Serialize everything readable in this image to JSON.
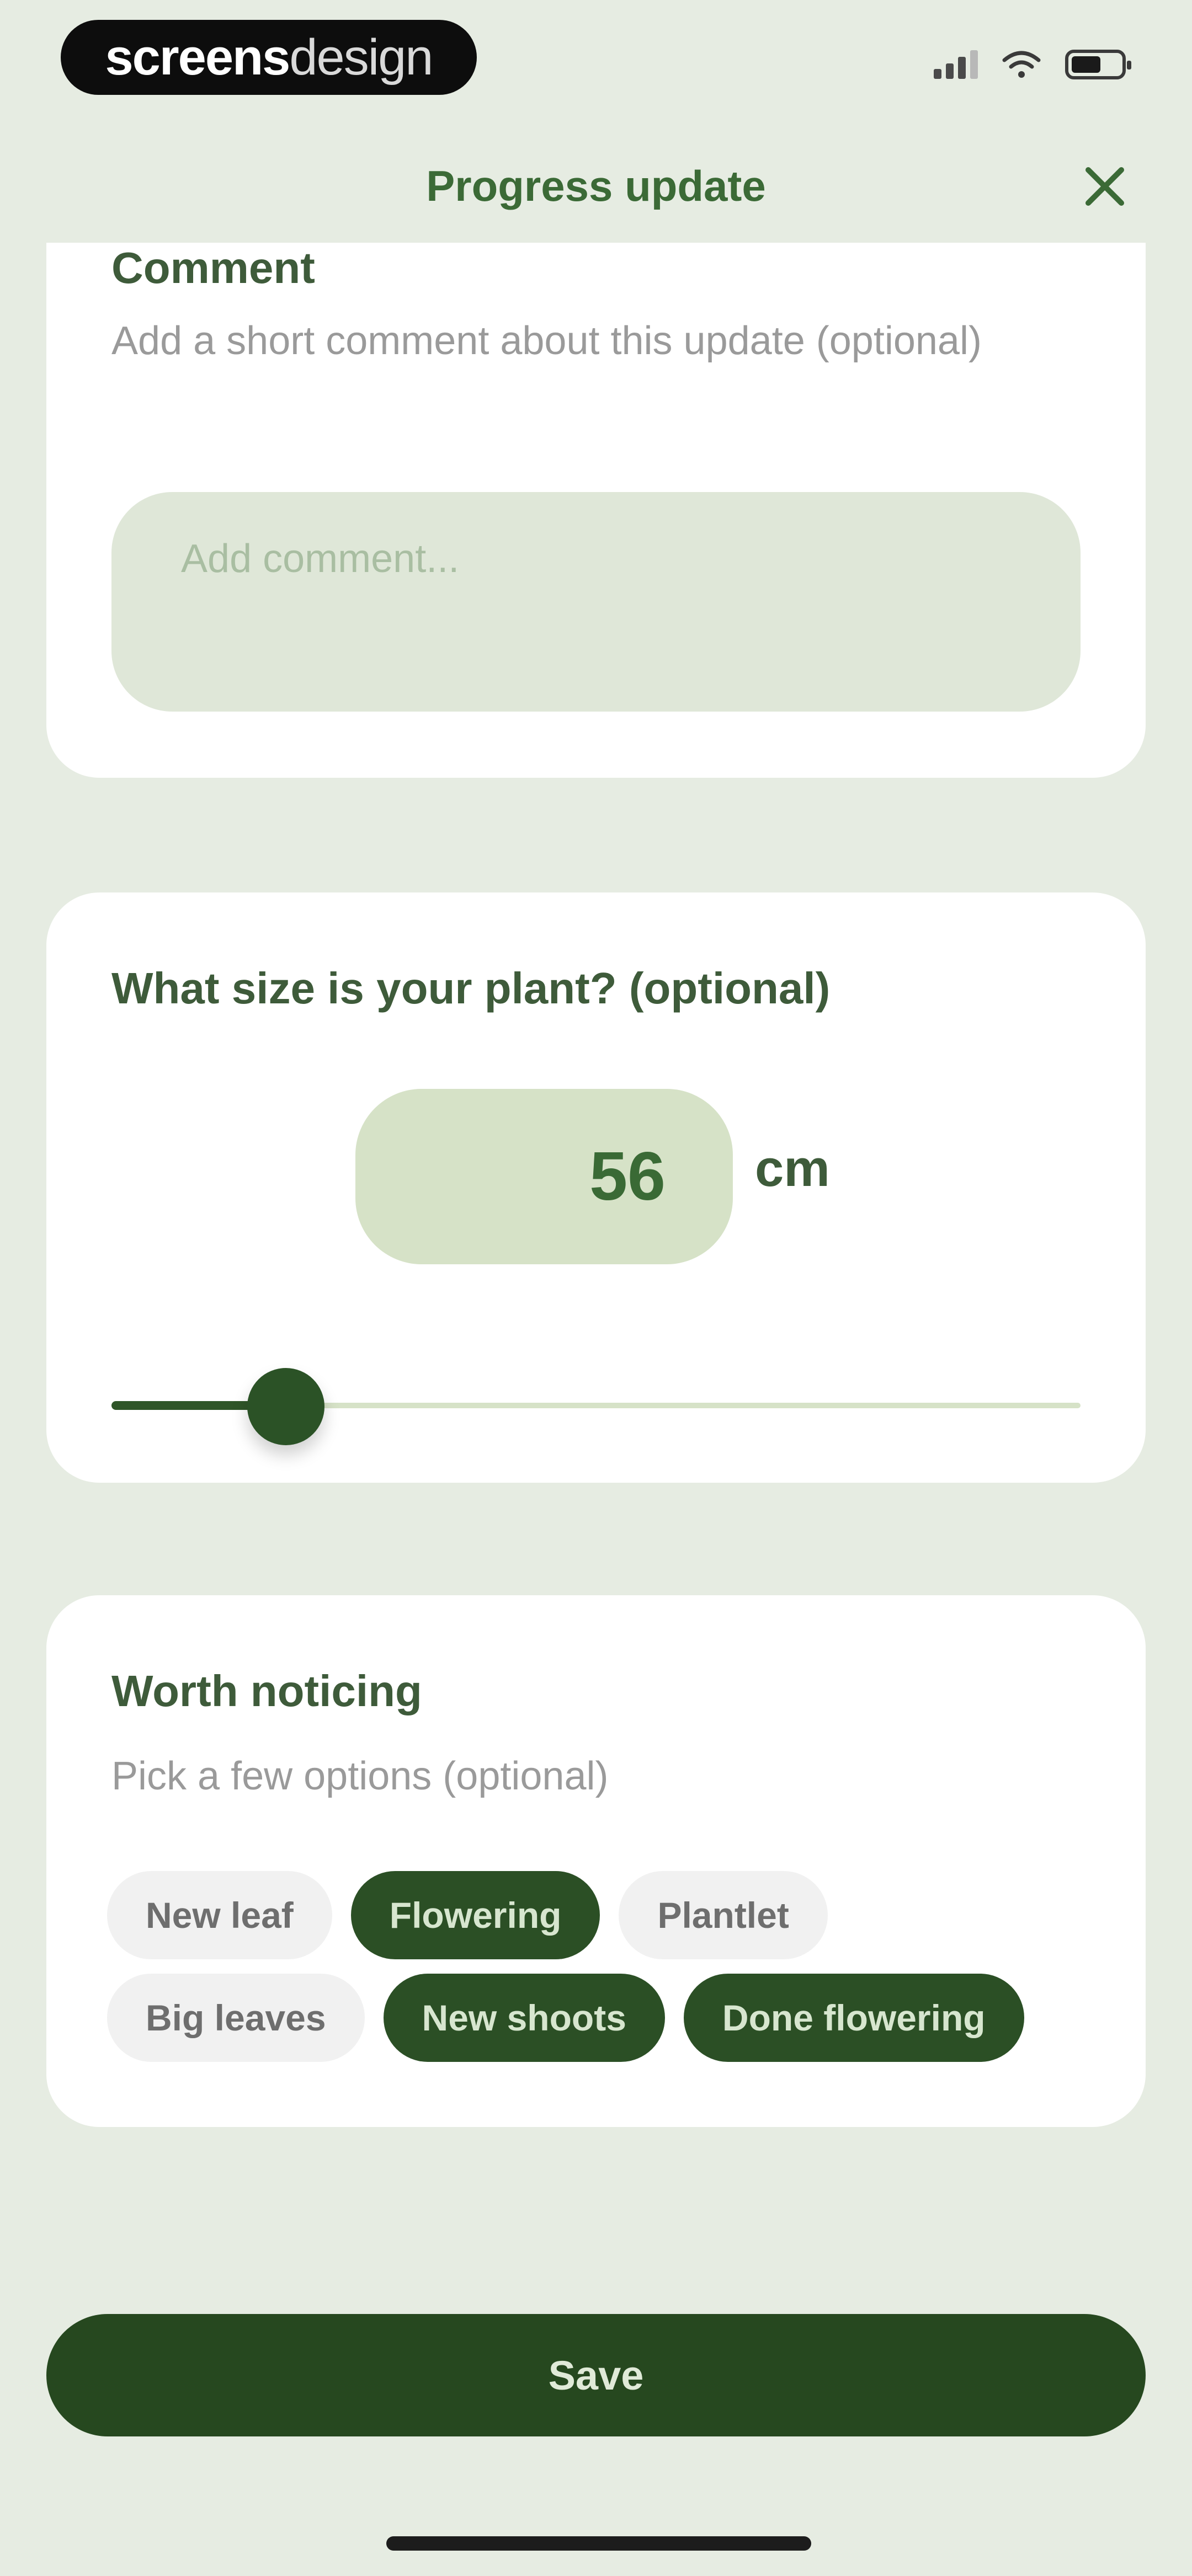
{
  "status_bar": {
    "logo_left": "screens",
    "logo_right": "design",
    "signal_icon": "cellular-signal-icon",
    "wifi_icon": "wifi-icon",
    "battery_icon": "battery-icon"
  },
  "header": {
    "title": "Progress update",
    "close_icon": "close-icon"
  },
  "comment": {
    "title": "Comment",
    "subtitle": "Add a short comment about this update (optional)",
    "placeholder": "Add comment...",
    "value": ""
  },
  "size": {
    "title": "What size is your plant? (optional)",
    "value": "56",
    "unit": "cm",
    "slider_fraction": 0.18
  },
  "worth": {
    "title": "Worth noticing",
    "subtitle": "Pick a few options (optional)",
    "chips": [
      {
        "label": "New leaf",
        "selected": false
      },
      {
        "label": "Flowering",
        "selected": true
      },
      {
        "label": "Plantlet",
        "selected": false
      },
      {
        "label": "Big leaves",
        "selected": false
      },
      {
        "label": "New shoots",
        "selected": true
      },
      {
        "label": "Done flowering",
        "selected": true
      }
    ]
  },
  "save_label": "Save",
  "colors": {
    "background": "#e6ece2",
    "accent_dark": "#26481f",
    "accent_text": "#3b6a36",
    "field_light": "#d6e2c7",
    "chip_unselected": "#f1f1f1"
  }
}
